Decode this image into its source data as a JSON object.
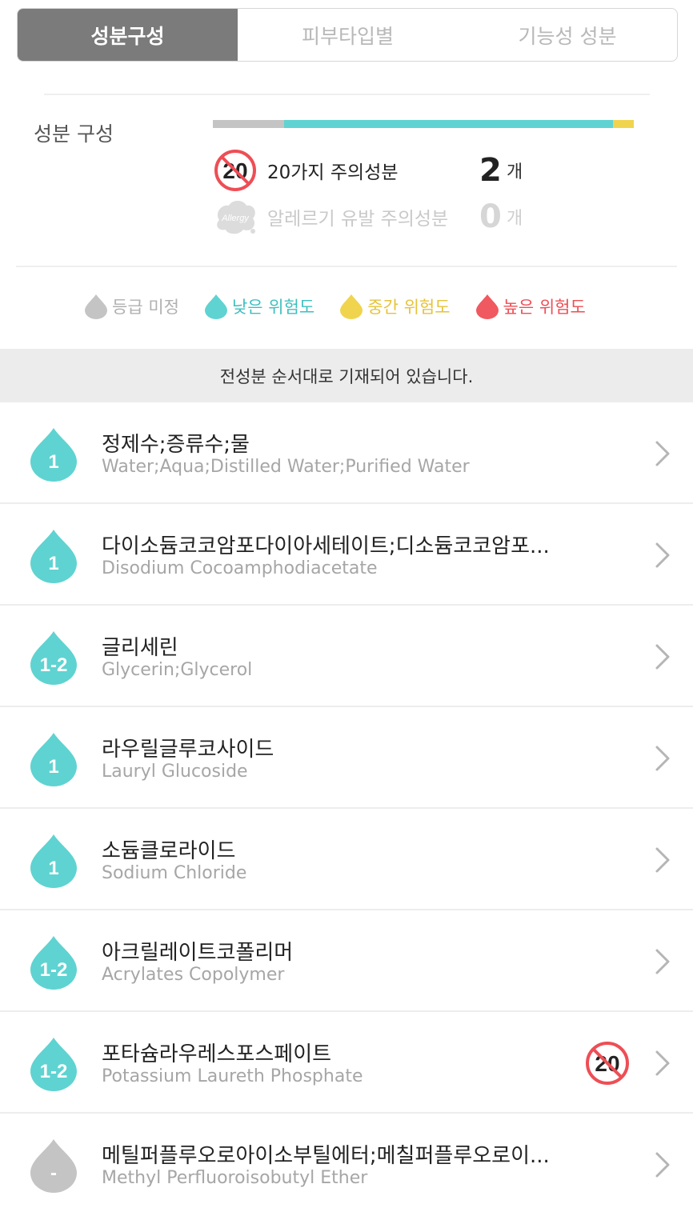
{
  "tabs": [
    {
      "label": "성분구성",
      "active": true
    },
    {
      "label": "피부타입별",
      "active": false
    },
    {
      "label": "기능성 성분",
      "active": false
    }
  ],
  "composition": {
    "title": "성분 구성",
    "bar": [
      {
        "color": "#c4c4c4",
        "fraction": 0.17
      },
      {
        "color": "#5fd3d1",
        "fraction": 0.78
      },
      {
        "color": "#f1d44e",
        "fraction": 0.05
      }
    ]
  },
  "warnings": {
    "twenty": {
      "label": "20가지 주의성분",
      "count": "2",
      "unit": "개",
      "icon": "20-caution-icon",
      "icon_text": "20"
    },
    "allergy": {
      "label": "알레르기 유발 주의성분",
      "count": "0",
      "unit": "개",
      "icon": "allergy-icon",
      "icon_text": "Allergy"
    }
  },
  "legend": [
    {
      "label": "등급 미정",
      "color": "#c4c4c4"
    },
    {
      "label": "낮은 위험도",
      "color": "#5fd3d1"
    },
    {
      "label": "중간 위험도",
      "color": "#f1d44e"
    },
    {
      "label": "높은 위험도",
      "color": "#f0595f"
    }
  ],
  "notice": "전성분 순서대로 기재되어 있습니다.",
  "ingredients": [
    {
      "grade": "1",
      "name_ko": "정제수;증류수;물",
      "name_en": "Water;Aqua;Distilled Water;Purified Water",
      "caution20": false,
      "color": "#5fd3d1"
    },
    {
      "grade": "1",
      "name_ko": "다이소듐코코암포다이아세테이트;디소듐코코암포...",
      "name_en": "Disodium Cocoamphodiacetate",
      "caution20": false,
      "color": "#5fd3d1"
    },
    {
      "grade": "1-2",
      "name_ko": "글리세린",
      "name_en": "Glycerin;Glycerol",
      "caution20": false,
      "color": "#5fd3d1"
    },
    {
      "grade": "1",
      "name_ko": "라우릴글루코사이드",
      "name_en": "Lauryl Glucoside",
      "caution20": false,
      "color": "#5fd3d1"
    },
    {
      "grade": "1",
      "name_ko": "소듐클로라이드",
      "name_en": "Sodium Chloride",
      "caution20": false,
      "color": "#5fd3d1"
    },
    {
      "grade": "1-2",
      "name_ko": "아크릴레이트코폴리머",
      "name_en": "Acrylates Copolymer",
      "caution20": false,
      "color": "#5fd3d1"
    },
    {
      "grade": "1-2",
      "name_ko": "포타슘라우레스포스페이트",
      "name_en": "Potassium Laureth Phosphate",
      "caution20": true,
      "caution20_text": "20",
      "color": "#5fd3d1"
    },
    {
      "grade": "-",
      "name_ko": "메틸퍼플루오로아이소부틸에터;메칠퍼플루오로이...",
      "name_en": "Methyl Perfluoroisobutyl Ether",
      "caution20": false,
      "color": "#c4c4c4"
    }
  ]
}
